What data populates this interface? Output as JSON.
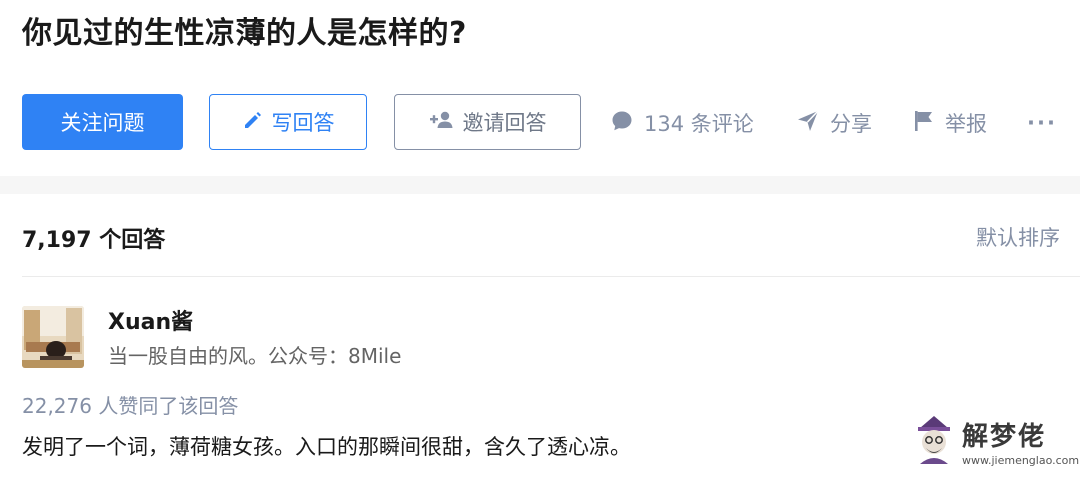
{
  "question": {
    "title": "你见过的生性凉薄的人是怎样的?"
  },
  "actions": {
    "follow_label": "关注问题",
    "write_label": "写回答",
    "invite_label": "邀请回答",
    "comments_label": "134 条评论",
    "share_label": "分享",
    "report_label": "举报",
    "more_label": "···"
  },
  "answers": {
    "count_label": "7,197 个回答",
    "sort_label": "默认排序"
  },
  "answer": {
    "author_name": "Xuan酱",
    "author_bio": "当一股自由的风。公众号：8Mile",
    "votes_label": "22,276 人赞同了该回答",
    "content": "发明了一个词，薄荷糖女孩。入口的那瞬间很甜，含久了透心凉。"
  },
  "watermark": {
    "title": "解梦佬",
    "url": "www.jiemenglao.com"
  },
  "colors": {
    "primary": "#2f82f4",
    "muted": "#8590a6",
    "text": "#1a1a1a",
    "background": "#f6f6f6"
  },
  "icons": [
    "pencil-icon",
    "add-user-icon",
    "comment-icon",
    "share-icon",
    "flag-icon",
    "more-icon"
  ]
}
